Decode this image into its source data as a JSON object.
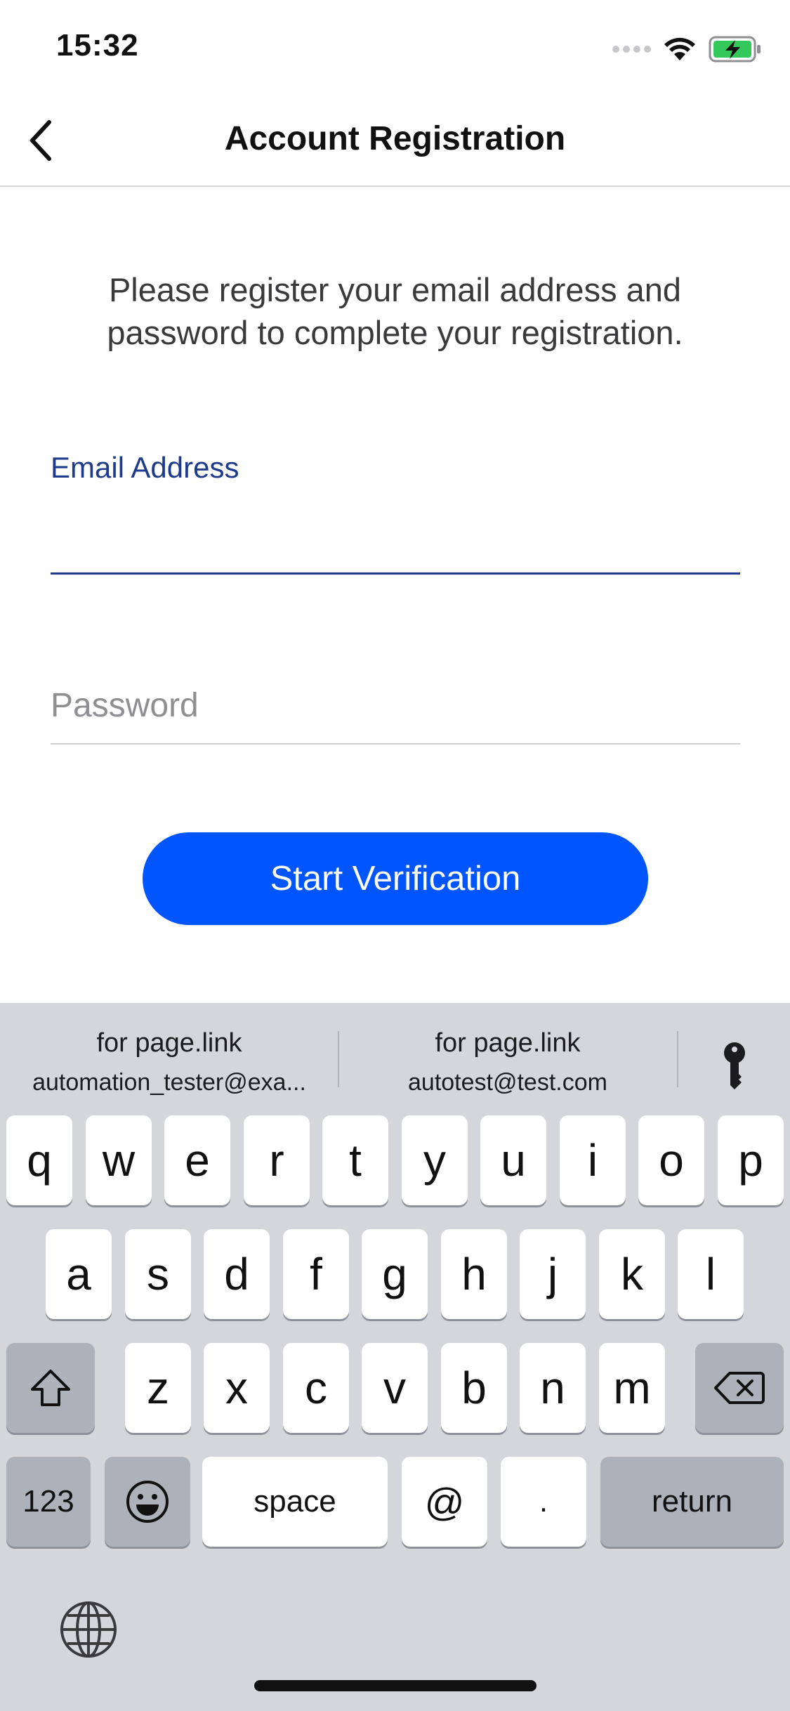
{
  "status": {
    "time": "15:32"
  },
  "nav": {
    "title": "Account Registration"
  },
  "form": {
    "instructions": "Please register your email address and password to complete your registration.",
    "email_label": "Email Address",
    "email_value": "",
    "password_placeholder": "Password",
    "submit_label": "Start Verification"
  },
  "keyboard": {
    "suggestions": [
      {
        "site": "for page.link",
        "account": "automation_tester@exa..."
      },
      {
        "site": "for page.link",
        "account": "autotest@test.com"
      }
    ],
    "row1": [
      "q",
      "w",
      "e",
      "r",
      "t",
      "y",
      "u",
      "i",
      "o",
      "p"
    ],
    "row2": [
      "a",
      "s",
      "d",
      "f",
      "g",
      "h",
      "j",
      "k",
      "l"
    ],
    "row3": [
      "z",
      "x",
      "c",
      "v",
      "b",
      "n",
      "m"
    ],
    "bottom": {
      "numbers": "123",
      "space": "space",
      "at": "@",
      "dot": ".",
      "return": "return"
    }
  },
  "colors": {
    "accent": "#0055ff",
    "label": "#1e3a8a",
    "keyboard_bg": "#d4d6dc"
  }
}
